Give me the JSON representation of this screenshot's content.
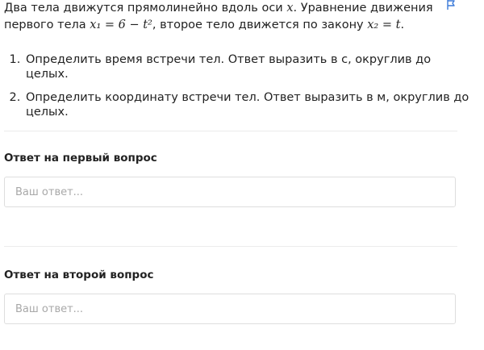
{
  "problem": {
    "text_1": "Два тела движутся прямолинейно вдоль оси ",
    "axis_var": "x",
    "text_2": ". Уравнение движения первого тела ",
    "eq1": "x₁ = 6 − t²",
    "text_3": ", второе тело движется по закону ",
    "eq2": "x₂ = t",
    "text_4": "."
  },
  "tasks": [
    "Определить время встречи тел. Ответ выразить в с, округлив до целых.",
    "Определить координату встречи тел. Ответ выразить в м, округлив до целых."
  ],
  "questions": [
    {
      "label": "Ответ на первый вопрос",
      "placeholder": "Ваш ответ..."
    },
    {
      "label": "Ответ на второй вопрос",
      "placeholder": "Ваш ответ..."
    }
  ],
  "icons": {
    "flag": "flag-icon"
  },
  "colors": {
    "accent": "#3b7ad9",
    "border": "#dedede",
    "divider": "#ececec"
  }
}
